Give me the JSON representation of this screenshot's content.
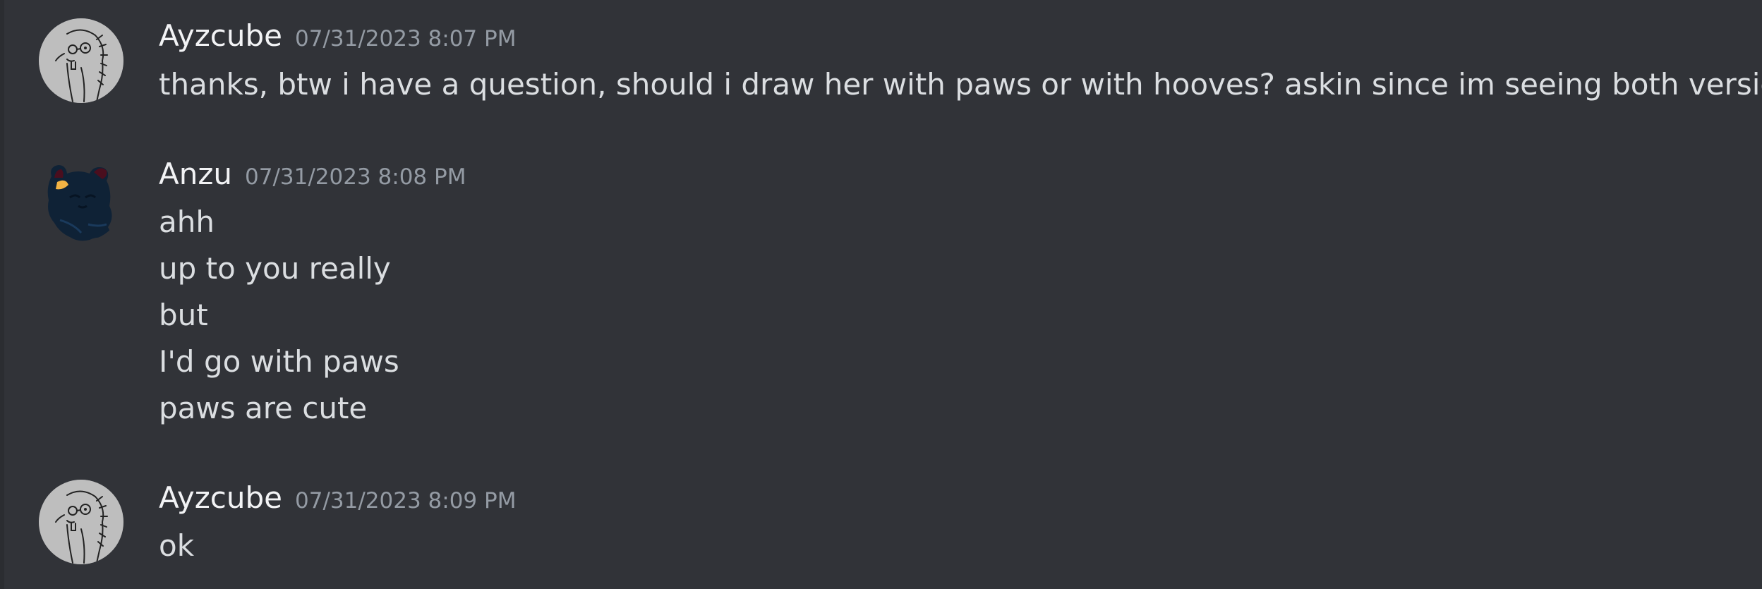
{
  "messages": [
    {
      "username": "Ayzcube",
      "timestamp": "07/31/2023 8:07 PM",
      "avatar_icon": "sketch-character-avatar",
      "lines": [
        "thanks, btw i have a question, should i draw her with paws or with hooves? askin since im seeing both versions"
      ]
    },
    {
      "username": "Anzu",
      "timestamp": "07/31/2023 8:08 PM",
      "avatar_icon": "dark-creature-avatar",
      "lines": [
        "ahh",
        "up to you really",
        "but",
        "I'd go with paws",
        "paws are cute"
      ]
    },
    {
      "username": "Ayzcube",
      "timestamp": "07/31/2023 8:09 PM",
      "avatar_icon": "sketch-character-avatar",
      "lines": [
        "ok"
      ]
    }
  ],
  "colors": {
    "background": "#313338",
    "username": "#f2f3f5",
    "timestamp": "#949ba4",
    "message_text": "#dbdee1"
  }
}
